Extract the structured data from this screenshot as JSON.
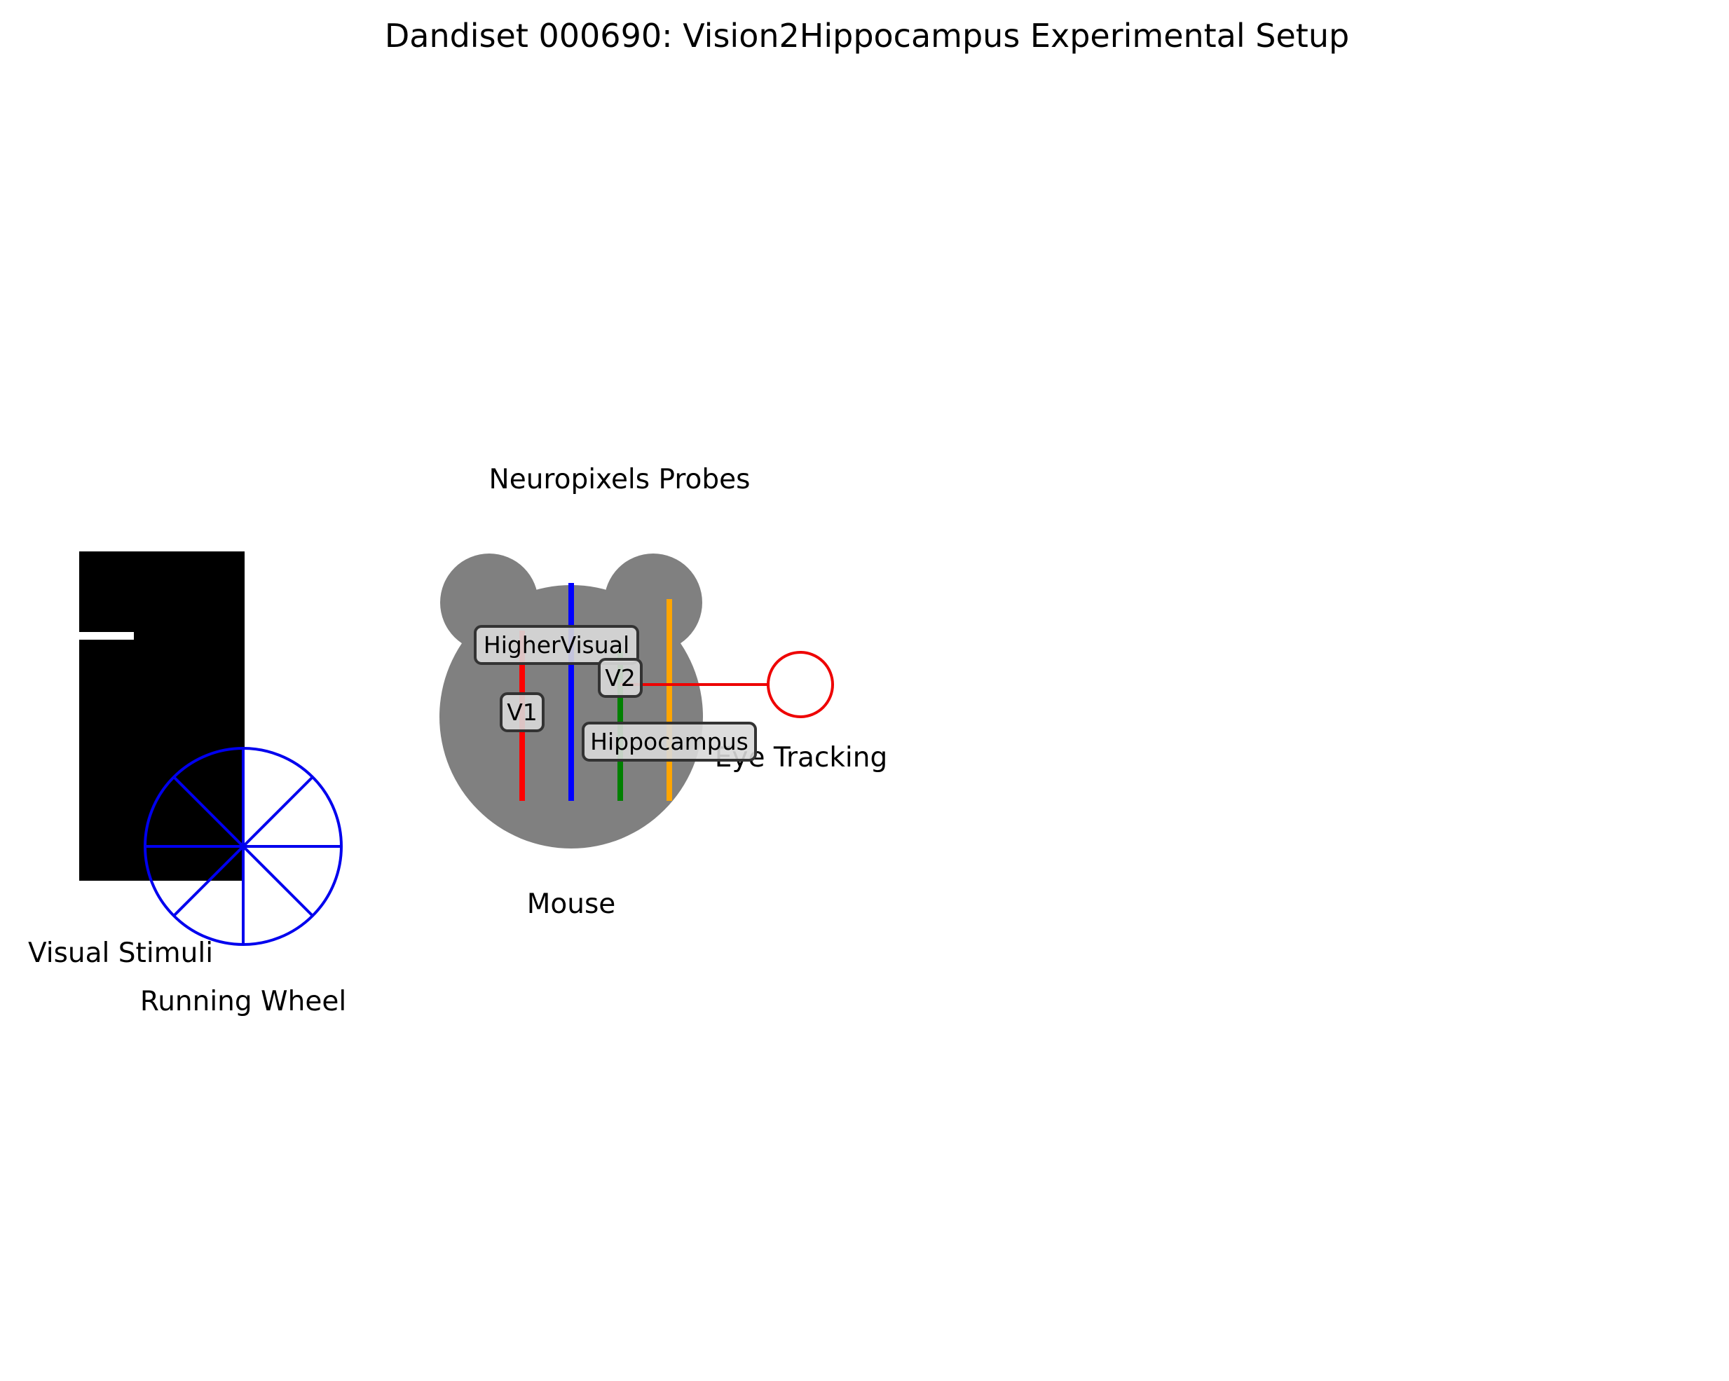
{
  "title": "Dandiset 000690: Vision2Hippocampus Experimental Setup",
  "labels": {
    "visual_stimuli": "Visual Stimuli",
    "running_wheel": "Running Wheel",
    "neuropixels_probes": "Neuropixels Probes",
    "mouse": "Mouse",
    "eye_tracking": "Eye Tracking"
  },
  "regions": {
    "higher_visual": "HigherVisual",
    "v1": "V1",
    "v2": "V2",
    "hippocampus": "Hippocampus"
  },
  "colors": {
    "screen": "#000000",
    "wheel": "#0000ee",
    "mouse_body": "#808080",
    "probe_v1": "#ff0000",
    "probe_higher_visual": "#0000ff",
    "probe_v2": "#008000",
    "probe_hippocampus": "#ffa500",
    "eye_tracker": "#ee0000",
    "label_box_fill": "#d9d9d9",
    "label_box_edge": "#333333"
  }
}
